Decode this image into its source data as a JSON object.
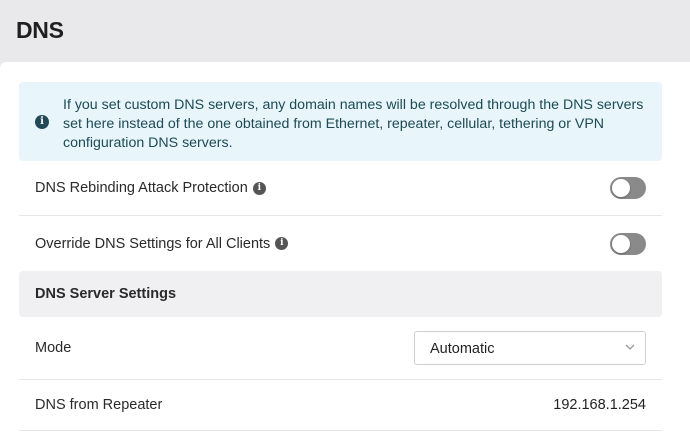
{
  "header": {
    "title": "DNS"
  },
  "info": {
    "text": "If you set custom DNS servers, any domain names will be resolved through the DNS servers set here instead of the one obtained from Ethernet, repeater, cellular, tethering or VPN configuration DNS servers."
  },
  "settings": {
    "rebinding": {
      "label": "DNS Rebinding Attack Protection",
      "enabled": false
    },
    "override": {
      "label": "Override DNS Settings for All Clients",
      "enabled": false
    }
  },
  "server_settings": {
    "title": "DNS Server Settings",
    "mode": {
      "label": "Mode",
      "value": "Automatic"
    },
    "repeater": {
      "label": "DNS from Repeater",
      "value": "192.168.1.254"
    }
  },
  "colors": {
    "info_bg": "#e8f5fa",
    "info_text": "#1d4a55",
    "toggle_off": "#8a8a8a"
  }
}
